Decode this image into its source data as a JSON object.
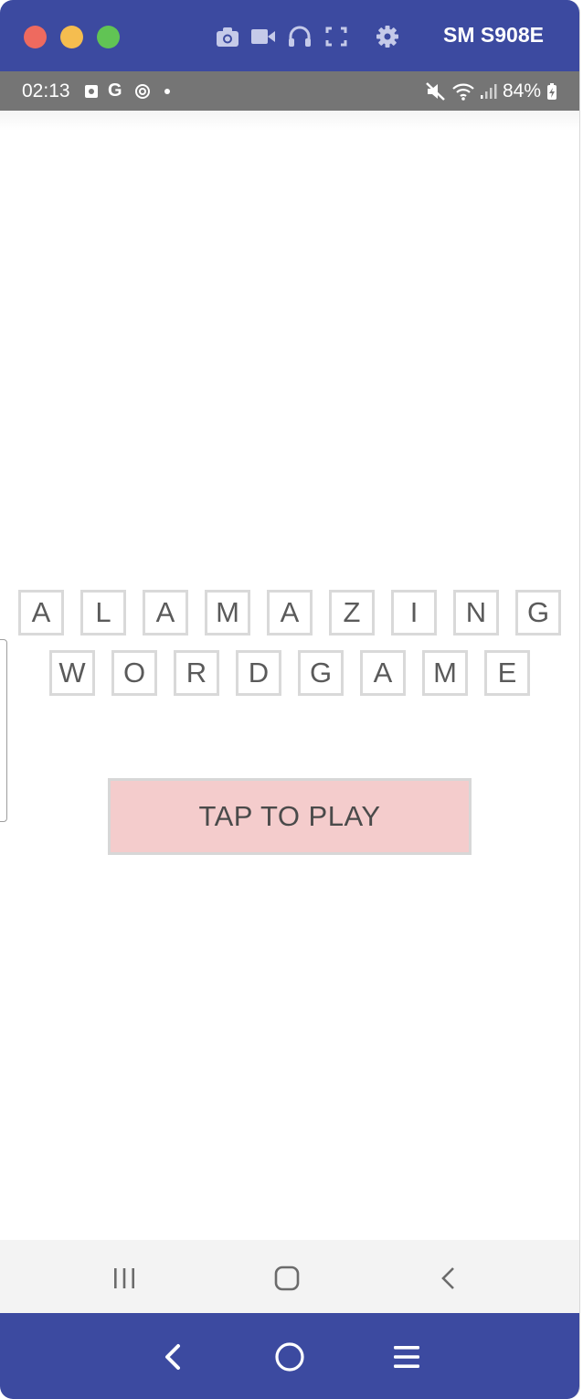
{
  "emulator": {
    "device_name": "SM S908E",
    "toolbar_icons": [
      "camera-icon",
      "video-icon",
      "headphones-icon",
      "fullscreen-icon",
      "settings-icon"
    ],
    "bottom_icons": [
      "back-icon",
      "home-icon",
      "menu-icon"
    ],
    "accent_color": "#3c4aa0"
  },
  "status_bar": {
    "time": "02:13",
    "battery": "84%",
    "icons": [
      "photo-icon",
      "google-icon",
      "sync-icon",
      "dot-icon",
      "mute-icon",
      "wifi-icon",
      "signal-icon",
      "battery-icon"
    ]
  },
  "game": {
    "title_row_1": [
      "A",
      "L",
      "A",
      "M",
      "A",
      "Z",
      "I",
      "N",
      "G"
    ],
    "title_row_2": [
      "W",
      "O",
      "R",
      "D",
      "G",
      "A",
      "M",
      "E"
    ],
    "play_button_label": "TAP TO PLAY",
    "play_button_color": "#f4cccc",
    "tile_border_color": "#d9d9d9"
  },
  "android_nav": {
    "icons": [
      "recents-icon",
      "home-icon",
      "back-icon"
    ]
  }
}
